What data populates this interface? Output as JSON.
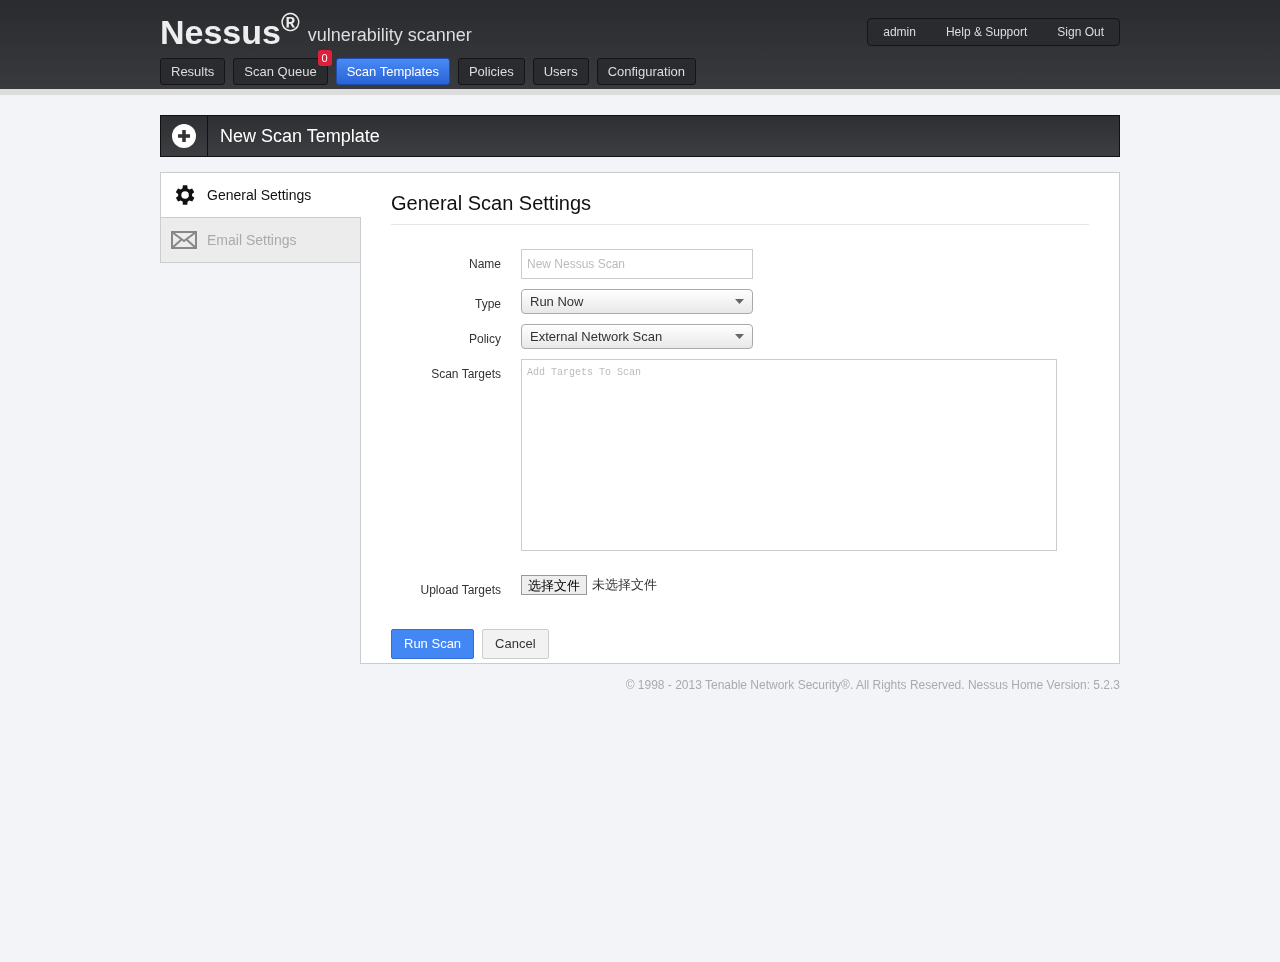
{
  "header": {
    "logo": "Nessus$^{®}$",
    "tagline": "vulnerability scanner",
    "nav": [
      {
        "label": "Results",
        "selected": false
      },
      {
        "label": "Scan Queue",
        "selected": false,
        "badge": "0"
      },
      {
        "label": "Scan Templates",
        "selected": true
      },
      {
        "label": "Policies",
        "selected": false
      },
      {
        "label": "Users",
        "selected": false
      },
      {
        "label": "Configuration",
        "selected": false
      }
    ],
    "user_menu": [
      "admin",
      "Help & Support",
      "Sign Out"
    ]
  },
  "page_title": "New Scan Template",
  "sidebar": {
    "items": [
      {
        "label": "General Settings",
        "kind": "gear",
        "selected": true
      },
      {
        "label": "Email Settings",
        "kind": "mail",
        "selected": false
      }
    ]
  },
  "form": {
    "title": "General Scan Settings",
    "fields": [
      {
        "kind": "text",
        "label": "Name",
        "placeholder": "New Nessus Scan"
      },
      {
        "kind": "select",
        "label": "Type",
        "value": "Run Now"
      },
      {
        "kind": "select",
        "label": "Policy",
        "value": "External Network Scan"
      },
      {
        "kind": "textarea",
        "label": "Scan Targets",
        "placeholder": "Add Targets To Scan"
      },
      {
        "kind": "file",
        "label": "Upload Targets",
        "button": "选择文件",
        "status": "未选择文件"
      }
    ],
    "buttons": [
      {
        "label": "Run Scan",
        "kind": "primary"
      },
      {
        "label": "Cancel",
        "kind": "default"
      }
    ]
  },
  "footer": "© 1998 - 2013 Tenable Network Security®. All Rights Reserved. Nessus Home Version: 5.2.3"
}
